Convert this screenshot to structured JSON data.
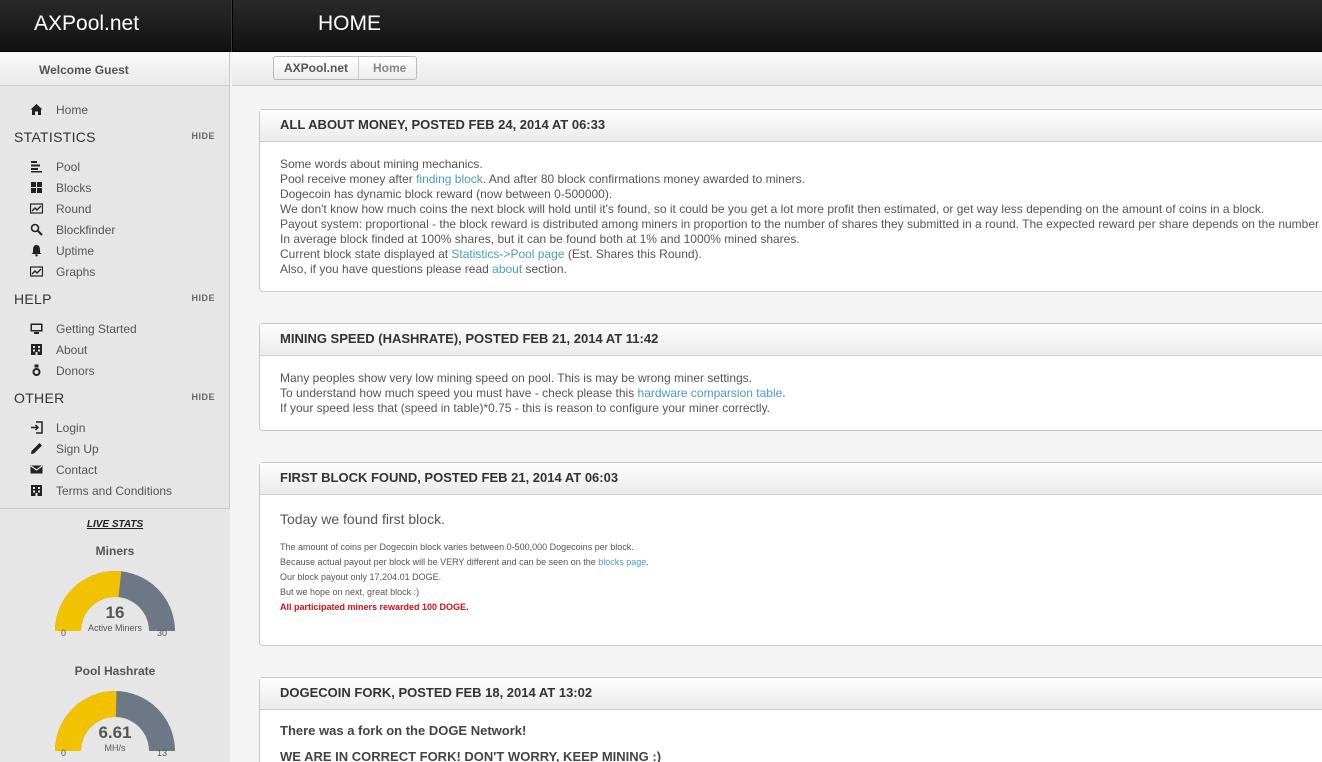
{
  "header": {
    "logo": "AXPool.net",
    "page_title": "HOME"
  },
  "sidebar": {
    "welcome": "Welcome Guest",
    "home": {
      "label": "Home",
      "icon": "home-icon"
    },
    "sections": [
      {
        "title": "STATISTICS",
        "hide_label": "HIDE",
        "items": [
          {
            "label": "Pool",
            "icon": "bars-icon"
          },
          {
            "label": "Blocks",
            "icon": "grid-icon"
          },
          {
            "label": "Round",
            "icon": "chart-icon"
          },
          {
            "label": "Blockfinder",
            "icon": "search-icon"
          },
          {
            "label": "Uptime",
            "icon": "bell-icon"
          },
          {
            "label": "Graphs",
            "icon": "chart-icon"
          }
        ]
      },
      {
        "title": "HELP",
        "hide_label": "HIDE",
        "items": [
          {
            "label": "Getting Started",
            "icon": "monitor-icon"
          },
          {
            "label": "About",
            "icon": "building-icon"
          },
          {
            "label": "Donors",
            "icon": "medal-icon"
          }
        ]
      },
      {
        "title": "OTHER",
        "hide_label": "HIDE",
        "items": [
          {
            "label": "Login",
            "icon": "login-icon"
          },
          {
            "label": "Sign Up",
            "icon": "pencil-icon"
          },
          {
            "label": "Contact",
            "icon": "envelope-icon"
          },
          {
            "label": "Terms and Conditions",
            "icon": "building-icon"
          }
        ]
      }
    ],
    "live_stats": {
      "title": "LIVE STATS",
      "miners": {
        "title": "Miners",
        "value": "16",
        "unit": "Active Miners",
        "min": "0",
        "max": "30",
        "fraction": 0.533
      },
      "hashrate": {
        "title": "Pool Hashrate",
        "value": "6.61",
        "unit": "MH/s",
        "min": "0",
        "max": "13",
        "fraction": 0.508
      }
    }
  },
  "breadcrumb": {
    "root": "AXPool.net",
    "current": "Home"
  },
  "posts": [
    {
      "title": "ALL ABOUT MONEY, POSTED FEB 24, 2014 AT 06:33",
      "line1": "Some words about mining mechanics.",
      "line2a": "Pool receive money after ",
      "line2_link": "finding block",
      "line2b": ". And after 80 block confirmations money awarded to miners.",
      "line3": "Dogecoin has dynamic block reward (now between 0-500000).",
      "line4": "We don't know how much coins the next block will hold until it's found, so it could be you get a lot more profit then estimated, or get way less depending on the amount of coins in a block.",
      "line5": "Payout system: proportional - the block reward is distributed among miners in proportion to the number of shares they submitted in a round. The expected reward per share depends on the number of shares needed to find a block.",
      "line6": "In average block finded at 100% shares, but it can be found both at 1% and 1000% mined shares.",
      "line7a": "Current block state displayed at ",
      "line7_link": "Statistics->Pool page",
      "line7b": " (Est. Shares this Round).",
      "line8a": "Also, if you have questions please read ",
      "line8_link": "about",
      "line8b": " section."
    },
    {
      "title": "MINING SPEED (HASHRATE), POSTED FEB 21, 2014 AT 11:42",
      "line1": "Many peoples show very low mining speed on pool. This is may be wrong miner settings.",
      "line2a": "To understand how much speed you must have - check please this ",
      "line2_link": "hardware comparsion table",
      "line2b": ".",
      "line3": "If your speed less that (speed in table)*0.75 - this is reason to configure your miner correctly."
    },
    {
      "title": "FIRST BLOCK FOUND, POSTED FEB 21, 2014 AT 06:03",
      "lead": "Today we found first block.",
      "line1": "The amount of coins per Dogecoin  block varies between 0-500,000 Dogecoins per block.",
      "line2a": "Because actual payout per block will be VERY different and can be seen on the ",
      "line2_link": "blocks page",
      "line2b": ".",
      "line3": "Our block payout only 17,204.01 DOGE.",
      "line4": "But we hope on next, great block :)",
      "line5": "All participated miners rewarded 100 DOGE."
    },
    {
      "title": "DOGECOIN FORK, POSTED FEB 18, 2014 AT 13:02",
      "lead": "There was a fork on the DOGE Network!",
      "line1": "WE ARE IN CORRECT FORK! DON'T WORRY, KEEP MINING :)"
    }
  ],
  "colors": {
    "gauge_fill": "#f2c200",
    "gauge_track": "#6e7785",
    "link": "#4a9cc7",
    "alert": "#d0131a"
  }
}
